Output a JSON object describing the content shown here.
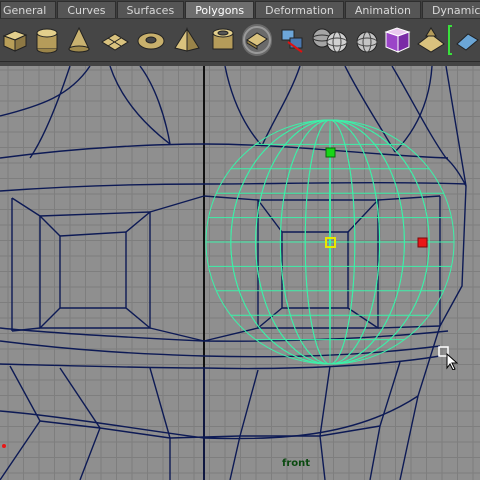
{
  "shelf": {
    "tabs": [
      {
        "label": "General"
      },
      {
        "label": "Curves"
      },
      {
        "label": "Surfaces"
      },
      {
        "label": "Polygons",
        "active": true
      },
      {
        "label": "Deformation"
      },
      {
        "label": "Animation"
      },
      {
        "label": "Dynamics"
      }
    ],
    "icons": [
      "poly-cube-icon",
      "poly-cylinder-icon",
      "poly-cone-icon",
      "poly-plane-icon",
      "poly-torus-icon",
      "poly-pyramid-icon",
      "poly-pipe-icon",
      "smooth-proxy-icon",
      "extrude-icon",
      "poly-sphere-small-icon",
      "poly-sphere-icon",
      "poly-sphere-alt-icon",
      "cube-purple-icon",
      "poly-plane-alt-icon",
      "selection-icon"
    ]
  },
  "viewport": {
    "camera_label": "front",
    "colors": {
      "wire": "#0d1a55",
      "selected_wire": "#3cf0a8",
      "handle_center": "#e8e800",
      "handle_top": "#17d617",
      "handle_right": "#e81717"
    }
  }
}
